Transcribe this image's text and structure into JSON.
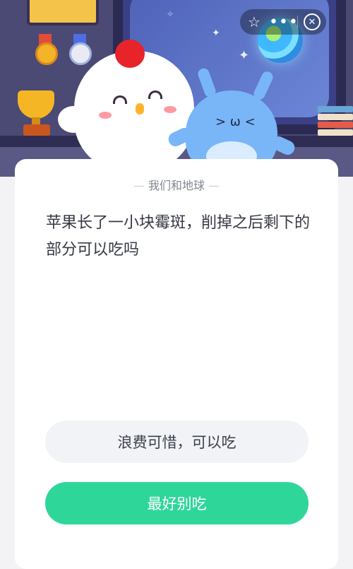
{
  "capsule": {
    "star_icon": "star-outline-icon",
    "more_icon": "more-dots-icon",
    "close_icon": "close-circle-icon",
    "star_glyph": "☆",
    "more_glyph": "•••",
    "close_glyph": "✕"
  },
  "quiz": {
    "category": "我们和地球",
    "question": "苹果长了一小块霉斑，削掉之后剩下的部分可以吃吗",
    "options": [
      {
        "label": "浪费可惜，可以吃"
      },
      {
        "label": "最好别吃"
      }
    ]
  },
  "colors": {
    "accent_green": "#2fd69a",
    "header_purple": "#4b4a74",
    "question_text": "#353843"
  }
}
